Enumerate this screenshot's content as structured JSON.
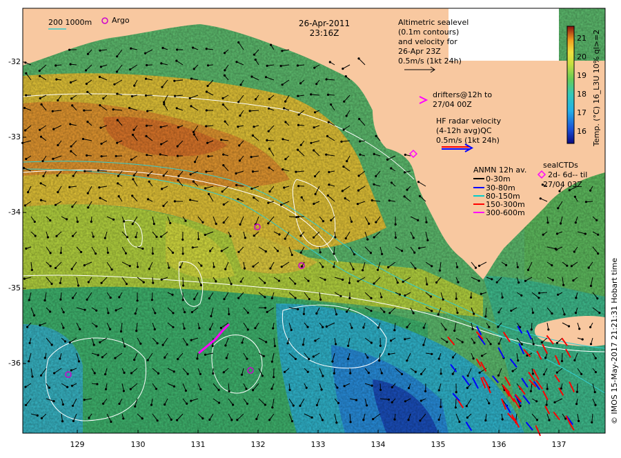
{
  "header": {
    "date": "26-Apr-2011",
    "time": "23:16Z"
  },
  "legend_topleft": {
    "isobath_label": "200  1000m",
    "argo_label": "Argo"
  },
  "altimetry_note": {
    "lines": [
      "Altimetric sealevel",
      "(0.1m contours)",
      "and velocity for",
      "26-Apr 23Z",
      "0.5m/s (1kt 24h)"
    ]
  },
  "drifters_note": {
    "lines": [
      "drifters@12h to",
      "27/04 00Z"
    ]
  },
  "hf_radar_note": {
    "lines": [
      "HF radar velocity",
      "(4-12h avg)QC",
      "0.5m/s (1kt 24h)"
    ]
  },
  "anmn_legend": {
    "title": "ANMN 12h av.",
    "items": [
      {
        "label": "0-30m",
        "color": "#000000"
      },
      {
        "label": "30-80m",
        "color": "#0000ff"
      },
      {
        "label": "80-150m",
        "color": "#00cccc"
      },
      {
        "label": "150-300m",
        "color": "#ff0000"
      },
      {
        "label": "300-600m",
        "color": "#ff00ff"
      }
    ]
  },
  "sealctd_legend": {
    "lines": [
      "sealCTDs",
      "2d- 6d-- til",
      "27/04 03Z"
    ]
  },
  "colorbar": {
    "label": "Temp. (°C) 16_L3U 10% ql>=2",
    "ticks": [
      "21",
      "20",
      "19",
      "18",
      "17",
      "16"
    ],
    "min": 15.4,
    "max": 21.6
  },
  "credit": "© IMOS 15-May-2017 21:21:31 Hobart time",
  "axes": {
    "y_ticks": [
      "-32",
      "-33",
      "-34",
      "-35",
      "-36"
    ],
    "x_ticks": [
      "129",
      "130",
      "131",
      "132",
      "133",
      "134",
      "135",
      "136",
      "137"
    ],
    "lon_range": [
      128.2,
      137.5
    ],
    "lat_range": [
      -36.9,
      -31.2
    ]
  },
  "colors": {
    "land": "#f8c8a0",
    "contour": "#ffffff",
    "argo": "#cc00cc",
    "sealctd": "#ff00ff"
  },
  "icons": [
    "argo-float-icon",
    "sealctd-diamond-icon",
    "drifter-chevron-icon",
    "velocity-arrow-icon"
  ]
}
